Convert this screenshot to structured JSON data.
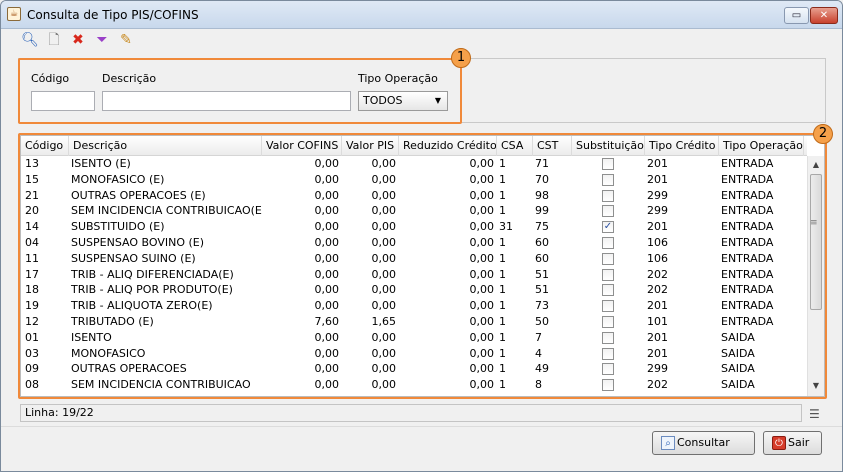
{
  "window": {
    "title": "Consulta de Tipo PIS/COFINS",
    "app_icon": "java-icon"
  },
  "toolbar": {
    "icons": [
      "search-icon",
      "new-document-icon",
      "delete-icon",
      "filter-icon",
      "edit-icon"
    ]
  },
  "annotations": {
    "filter_badge": "1",
    "grid_badge": "2",
    "accent_color": "#f0893a"
  },
  "filter": {
    "codigo_label": "Código",
    "descricao_label": "Descrição",
    "tipo_operacao_label": "Tipo Operação",
    "codigo_value": "",
    "descricao_value": "",
    "tipo_operacao_value": "TODOS"
  },
  "grid": {
    "columns": [
      "Código",
      "Descrição",
      "Valor COFINS",
      "Valor PIS",
      "Reduzido Crédito",
      "CSA",
      "CST",
      "Substituição",
      "Tipo Crédito",
      "Tipo Operação"
    ],
    "rows": [
      {
        "codigo": "13",
        "descricao": "ISENTO (E)",
        "cofins": "0,00",
        "pis": "0,00",
        "reduzido": "0,00",
        "csa": "1",
        "cst": "71",
        "subst": false,
        "tipo_credito": "201",
        "tipo_operacao": "ENTRADA"
      },
      {
        "codigo": "15",
        "descricao": "MONOFASICO (E)",
        "cofins": "0,00",
        "pis": "0,00",
        "reduzido": "0,00",
        "csa": "1",
        "cst": "70",
        "subst": false,
        "tipo_credito": "201",
        "tipo_operacao": "ENTRADA"
      },
      {
        "codigo": "21",
        "descricao": "OUTRAS OPERACOES (E)",
        "cofins": "0,00",
        "pis": "0,00",
        "reduzido": "0,00",
        "csa": "1",
        "cst": "98",
        "subst": false,
        "tipo_credito": "299",
        "tipo_operacao": "ENTRADA"
      },
      {
        "codigo": "20",
        "descricao": "SEM INCIDENCIA CONTRIBUICAO(E)",
        "cofins": "0,00",
        "pis": "0,00",
        "reduzido": "0,00",
        "csa": "1",
        "cst": "99",
        "subst": false,
        "tipo_credito": "299",
        "tipo_operacao": "ENTRADA"
      },
      {
        "codigo": "14",
        "descricao": "SUBSTITUIDO (E)",
        "cofins": "0,00",
        "pis": "0,00",
        "reduzido": "0,00",
        "csa": "31",
        "cst": "75",
        "subst": true,
        "tipo_credito": "201",
        "tipo_operacao": "ENTRADA"
      },
      {
        "codigo": "04",
        "descricao": "SUSPENSAO BOVINO (E)",
        "cofins": "0,00",
        "pis": "0,00",
        "reduzido": "0,00",
        "csa": "1",
        "cst": "60",
        "subst": false,
        "tipo_credito": "106",
        "tipo_operacao": "ENTRADA"
      },
      {
        "codigo": "11",
        "descricao": "SUSPENSAO SUINO (E)",
        "cofins": "0,00",
        "pis": "0,00",
        "reduzido": "0,00",
        "csa": "1",
        "cst": "60",
        "subst": false,
        "tipo_credito": "106",
        "tipo_operacao": "ENTRADA"
      },
      {
        "codigo": "17",
        "descricao": "TRIB - ALIQ DIFERENCIADA(E)",
        "cofins": "0,00",
        "pis": "0,00",
        "reduzido": "0,00",
        "csa": "1",
        "cst": "51",
        "subst": false,
        "tipo_credito": "202",
        "tipo_operacao": "ENTRADA"
      },
      {
        "codigo": "18",
        "descricao": "TRIB - ALIQ POR PRODUTO(E)",
        "cofins": "0,00",
        "pis": "0,00",
        "reduzido": "0,00",
        "csa": "1",
        "cst": "51",
        "subst": false,
        "tipo_credito": "202",
        "tipo_operacao": "ENTRADA"
      },
      {
        "codigo": "19",
        "descricao": "TRIB - ALIQUOTA ZERO(E)",
        "cofins": "0,00",
        "pis": "0,00",
        "reduzido": "0,00",
        "csa": "1",
        "cst": "73",
        "subst": false,
        "tipo_credito": "201",
        "tipo_operacao": "ENTRADA"
      },
      {
        "codigo": "12",
        "descricao": "TRIBUTADO (E)",
        "cofins": "7,60",
        "pis": "1,65",
        "reduzido": "0,00",
        "csa": "1",
        "cst": "50",
        "subst": false,
        "tipo_credito": "101",
        "tipo_operacao": "ENTRADA"
      },
      {
        "codigo": "01",
        "descricao": "ISENTO",
        "cofins": "0,00",
        "pis": "0,00",
        "reduzido": "0,00",
        "csa": "1",
        "cst": "7",
        "subst": false,
        "tipo_credito": "201",
        "tipo_operacao": "SAIDA"
      },
      {
        "codigo": "03",
        "descricao": "MONOFASICO",
        "cofins": "0,00",
        "pis": "0,00",
        "reduzido": "0,00",
        "csa": "1",
        "cst": "4",
        "subst": false,
        "tipo_credito": "201",
        "tipo_operacao": "SAIDA"
      },
      {
        "codigo": "09",
        "descricao": "OUTRAS OPERACOES",
        "cofins": "0,00",
        "pis": "0,00",
        "reduzido": "0,00",
        "csa": "1",
        "cst": "49",
        "subst": false,
        "tipo_credito": "299",
        "tipo_operacao": "SAIDA"
      },
      {
        "codigo": "08",
        "descricao": "SEM INCIDENCIA CONTRIBUICAO",
        "cofins": "0,00",
        "pis": "0,00",
        "reduzido": "0,00",
        "csa": "1",
        "cst": "8",
        "subst": false,
        "tipo_credito": "202",
        "tipo_operacao": "SAIDA"
      }
    ]
  },
  "status": {
    "text": "Linha: 19/22"
  },
  "buttons": {
    "consultar": "Consultar",
    "sair": "Sair"
  }
}
